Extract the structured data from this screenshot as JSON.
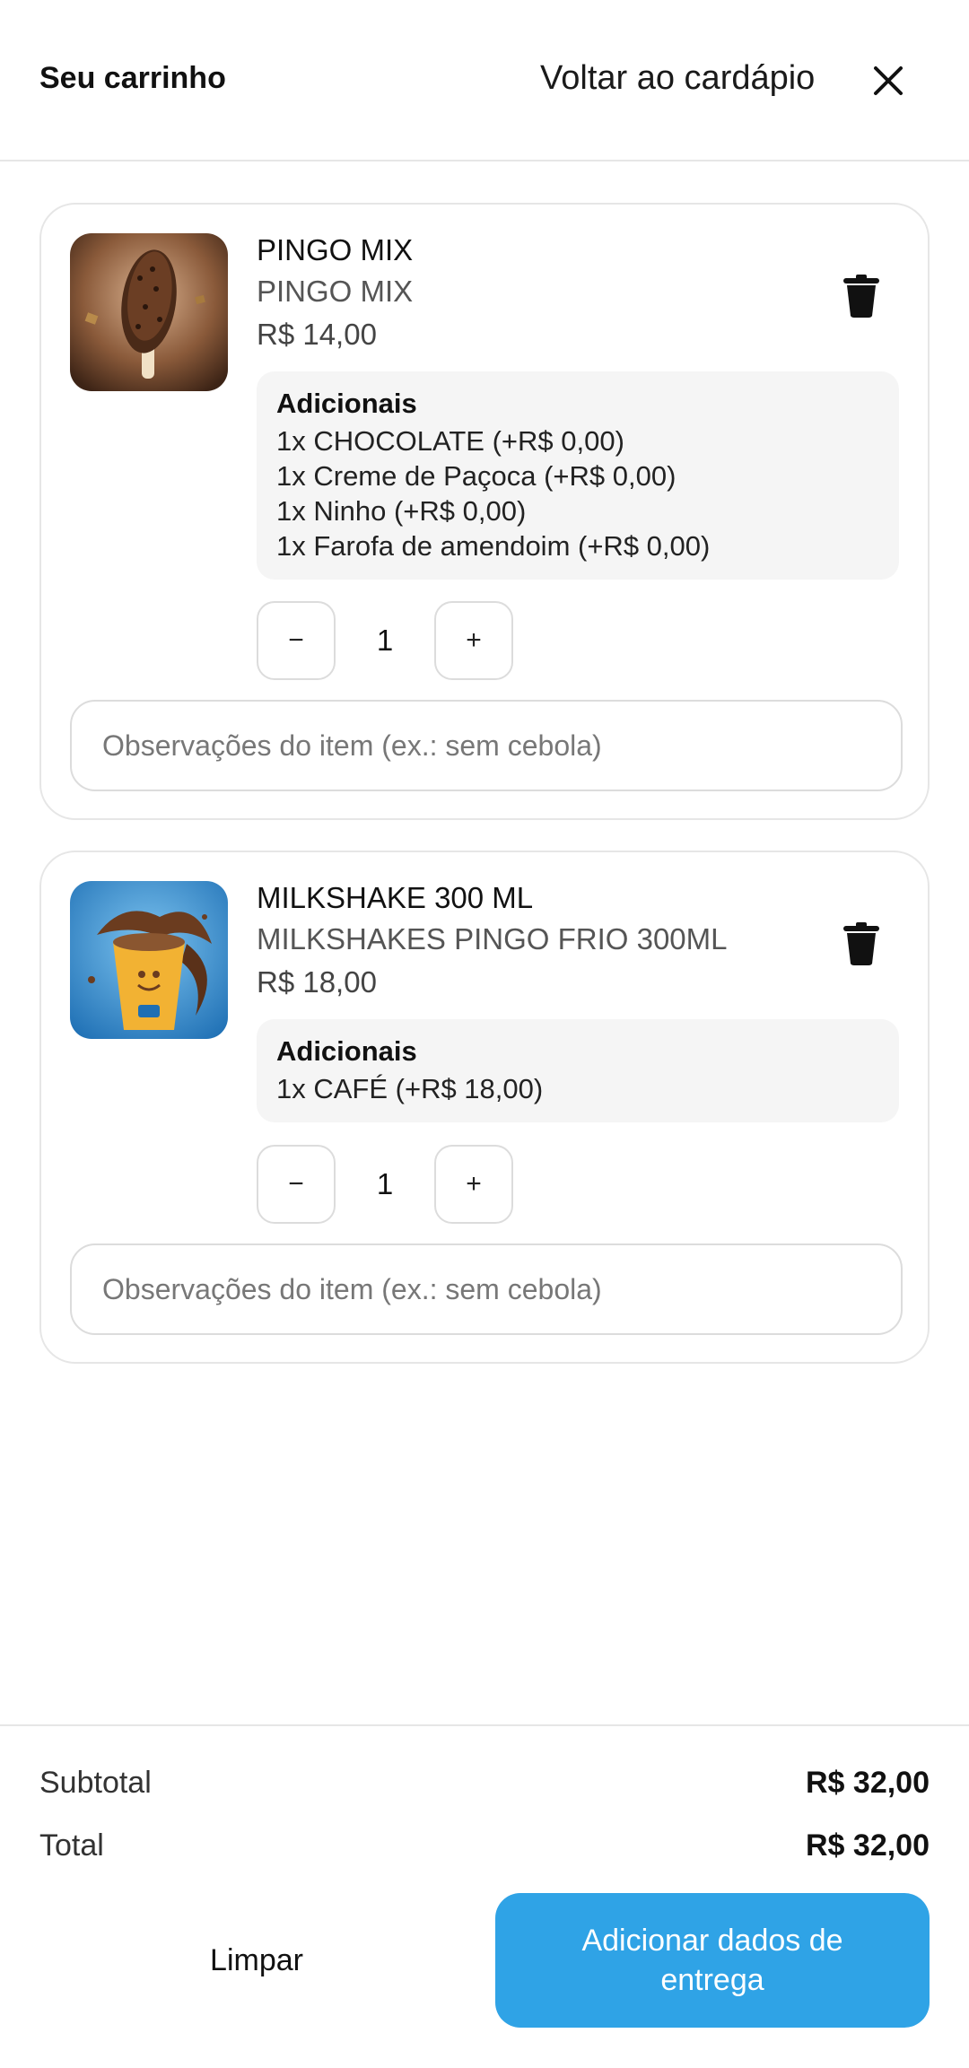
{
  "header": {
    "title": "Seu carrinho",
    "back_label": "Voltar ao cardápio",
    "close_icon": "close-icon"
  },
  "items": [
    {
      "name": "PINGO MIX",
      "subtitle": "PINGO MIX",
      "price": "R$ 14,00",
      "addons_title": "Adicionais",
      "addons": [
        "1x CHOCOLATE (+R$ 0,00)",
        "1x Creme de Paçoca (+R$ 0,00)",
        "1x Ninho (+R$ 0,00)",
        "1x Farofa de amendoim (+R$ 0,00)"
      ],
      "quantity": "1",
      "minus": "−",
      "plus": "+",
      "note_placeholder": "Observações do item (ex.: sem cebola)",
      "image": "chocolate-popsicle-image"
    },
    {
      "name": "MILKSHAKE 300 ML",
      "subtitle": "MILKSHAKES PINGO FRIO 300ML",
      "price": "R$ 18,00",
      "addons_title": "Adicionais",
      "addons": [
        "1x CAFÉ (+R$ 18,00)"
      ],
      "quantity": "1",
      "minus": "−",
      "plus": "+",
      "note_placeholder": "Observações do item (ex.: sem cebola)",
      "image": "milkshake-cup-image"
    }
  ],
  "summary": {
    "subtotal_label": "Subtotal",
    "subtotal_value": "R$ 32,00",
    "total_label": "Total",
    "total_value": "R$ 32,00"
  },
  "actions": {
    "clear_label": "Limpar",
    "submit_label": "Adicionar dados de entrega"
  },
  "colors": {
    "accent": "#2fa3e6",
    "border": "#e6e6e6",
    "addon_bg": "#f5f5f5"
  }
}
